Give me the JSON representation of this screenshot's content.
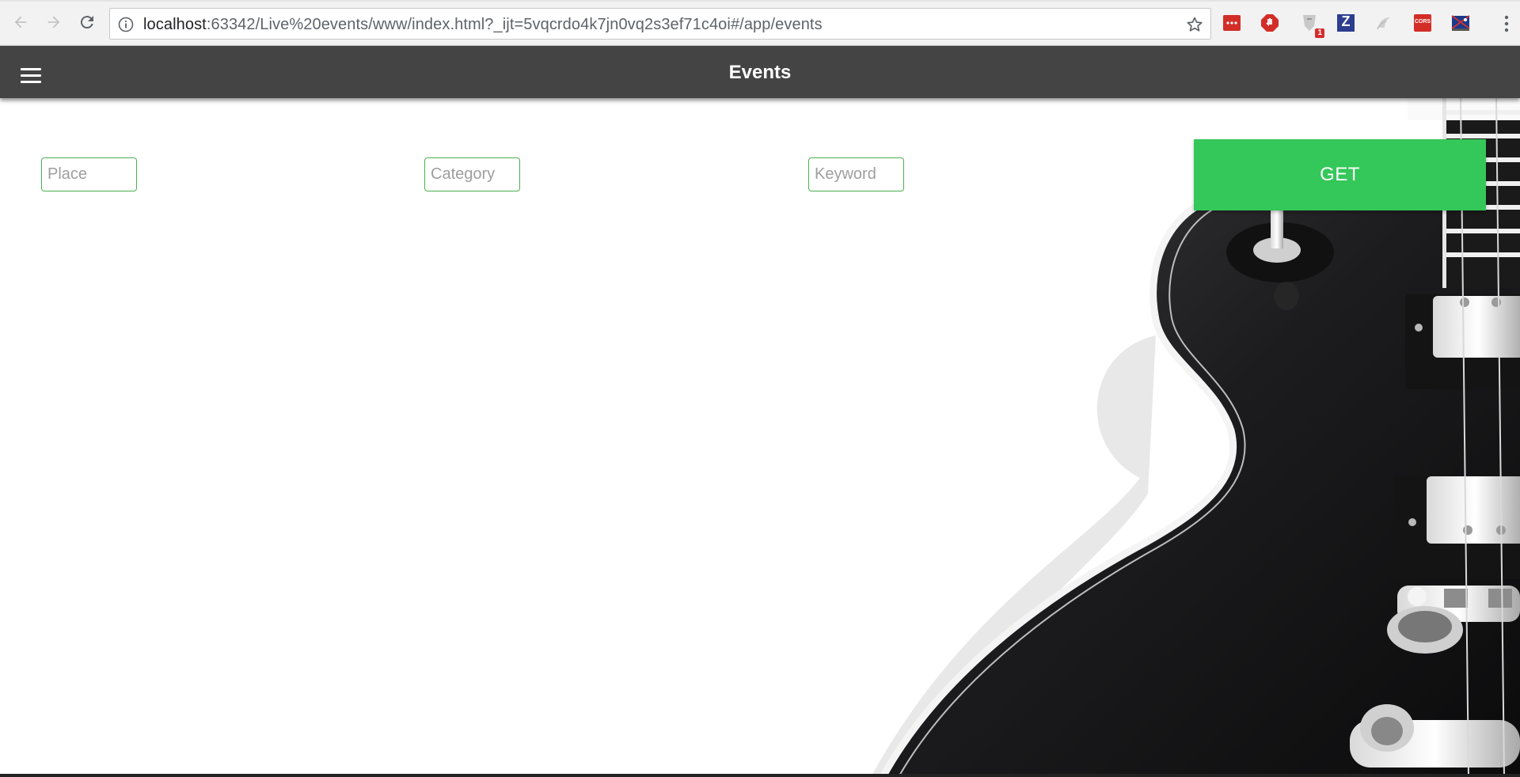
{
  "browser": {
    "url_host": "localhost",
    "url_rest": ":63342/Live%20events/www/index.html?_ijt=5vqcrdo4k7jn0vq2s3ef71c4oi#/app/events",
    "extensions": [
      {
        "name": "lastpass-icon"
      },
      {
        "name": "adblock-icon"
      },
      {
        "name": "ghostery-icon",
        "badge": "1"
      },
      {
        "name": "zotero-icon",
        "text": "Z"
      },
      {
        "name": "shadow-extension-icon"
      },
      {
        "name": "cors-icon",
        "text": "CORS"
      },
      {
        "name": "flag-extension-icon"
      }
    ]
  },
  "app": {
    "title": "Events"
  },
  "search": {
    "place_placeholder": "Place",
    "category_placeholder": "Category",
    "keyword_placeholder": "Keyword",
    "get_label": "GET"
  },
  "colors": {
    "appbar": "#444444",
    "accent": "#34c759",
    "field_border": "#4caf50"
  }
}
